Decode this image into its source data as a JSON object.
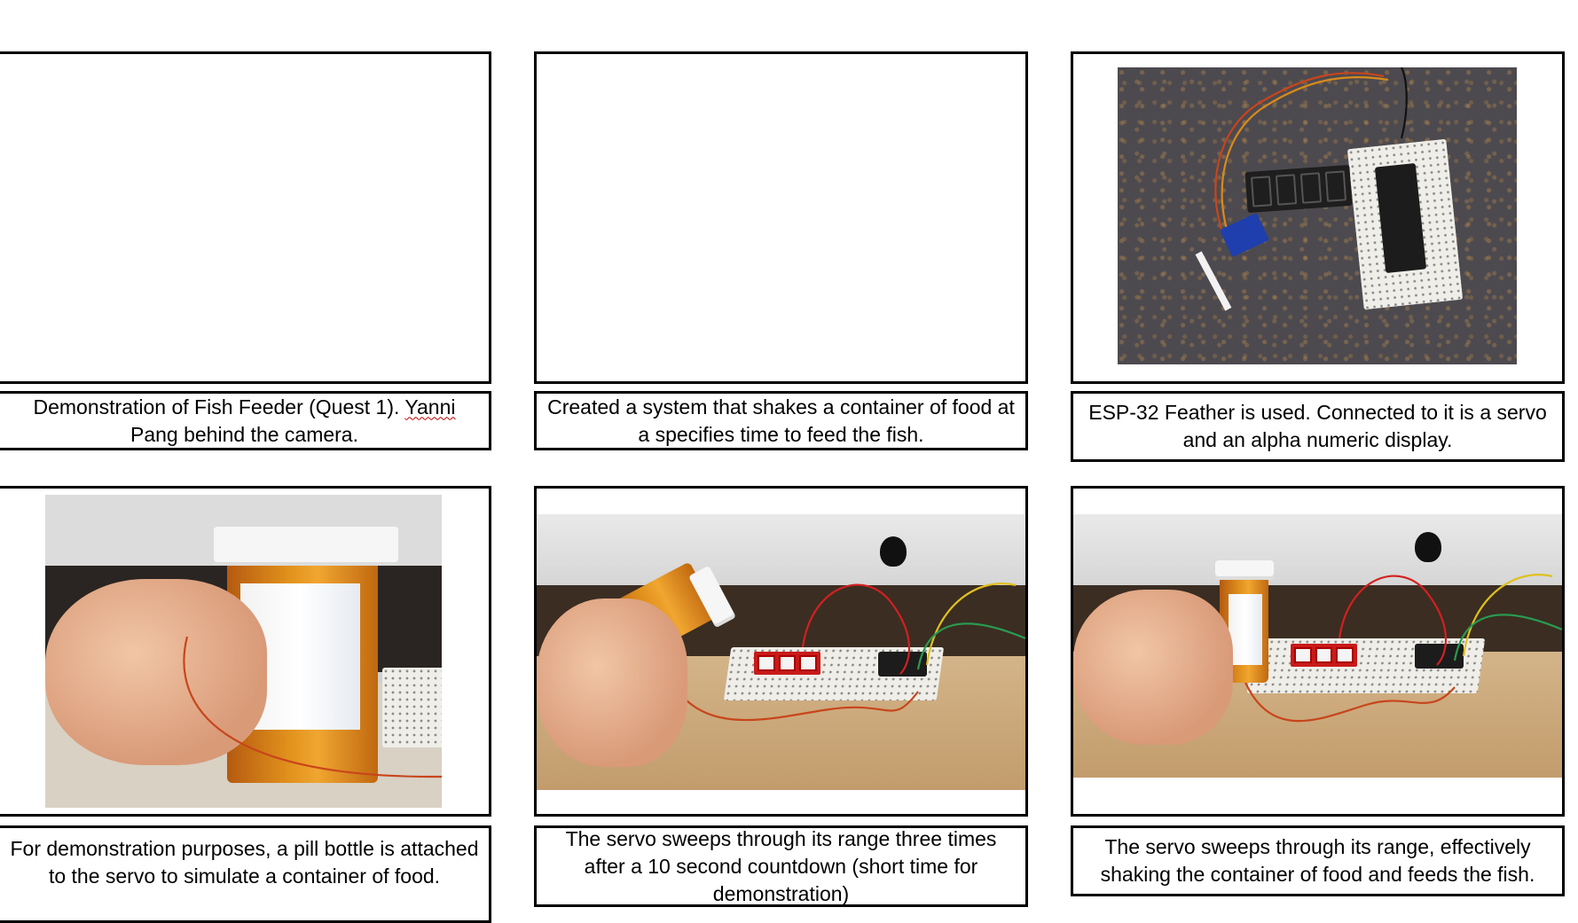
{
  "panels": [
    {
      "caption_pre": "Demonstration of Fish Feeder (Quest 1). ",
      "caption_underlined": "Yanni",
      "caption_post": " Pang behind the camera."
    },
    {
      "caption": "Created a system that shakes a container of food at a specifies time to feed the fish."
    },
    {
      "caption": "ESP-32 Feather is used. Connected to it is a servo and an alpha numeric display."
    },
    {
      "caption": "For demonstration purposes, a pill bottle is attached to the servo to simulate a container of food."
    },
    {
      "caption": "The servo sweeps through its range three times after a 10 second countdown (short time  for demonstration)"
    },
    {
      "caption": "The servo sweeps through its range, effectively shaking the container of food and feeds the fish."
    }
  ],
  "colors": {
    "border": "#000000",
    "spellcheck_underline": "#c00000",
    "servo_blue": "#1f3fae",
    "display_red": "#c91a1a",
    "bottle_orange": "#e0901c"
  },
  "icons": [
    "apple-logo-icon"
  ]
}
